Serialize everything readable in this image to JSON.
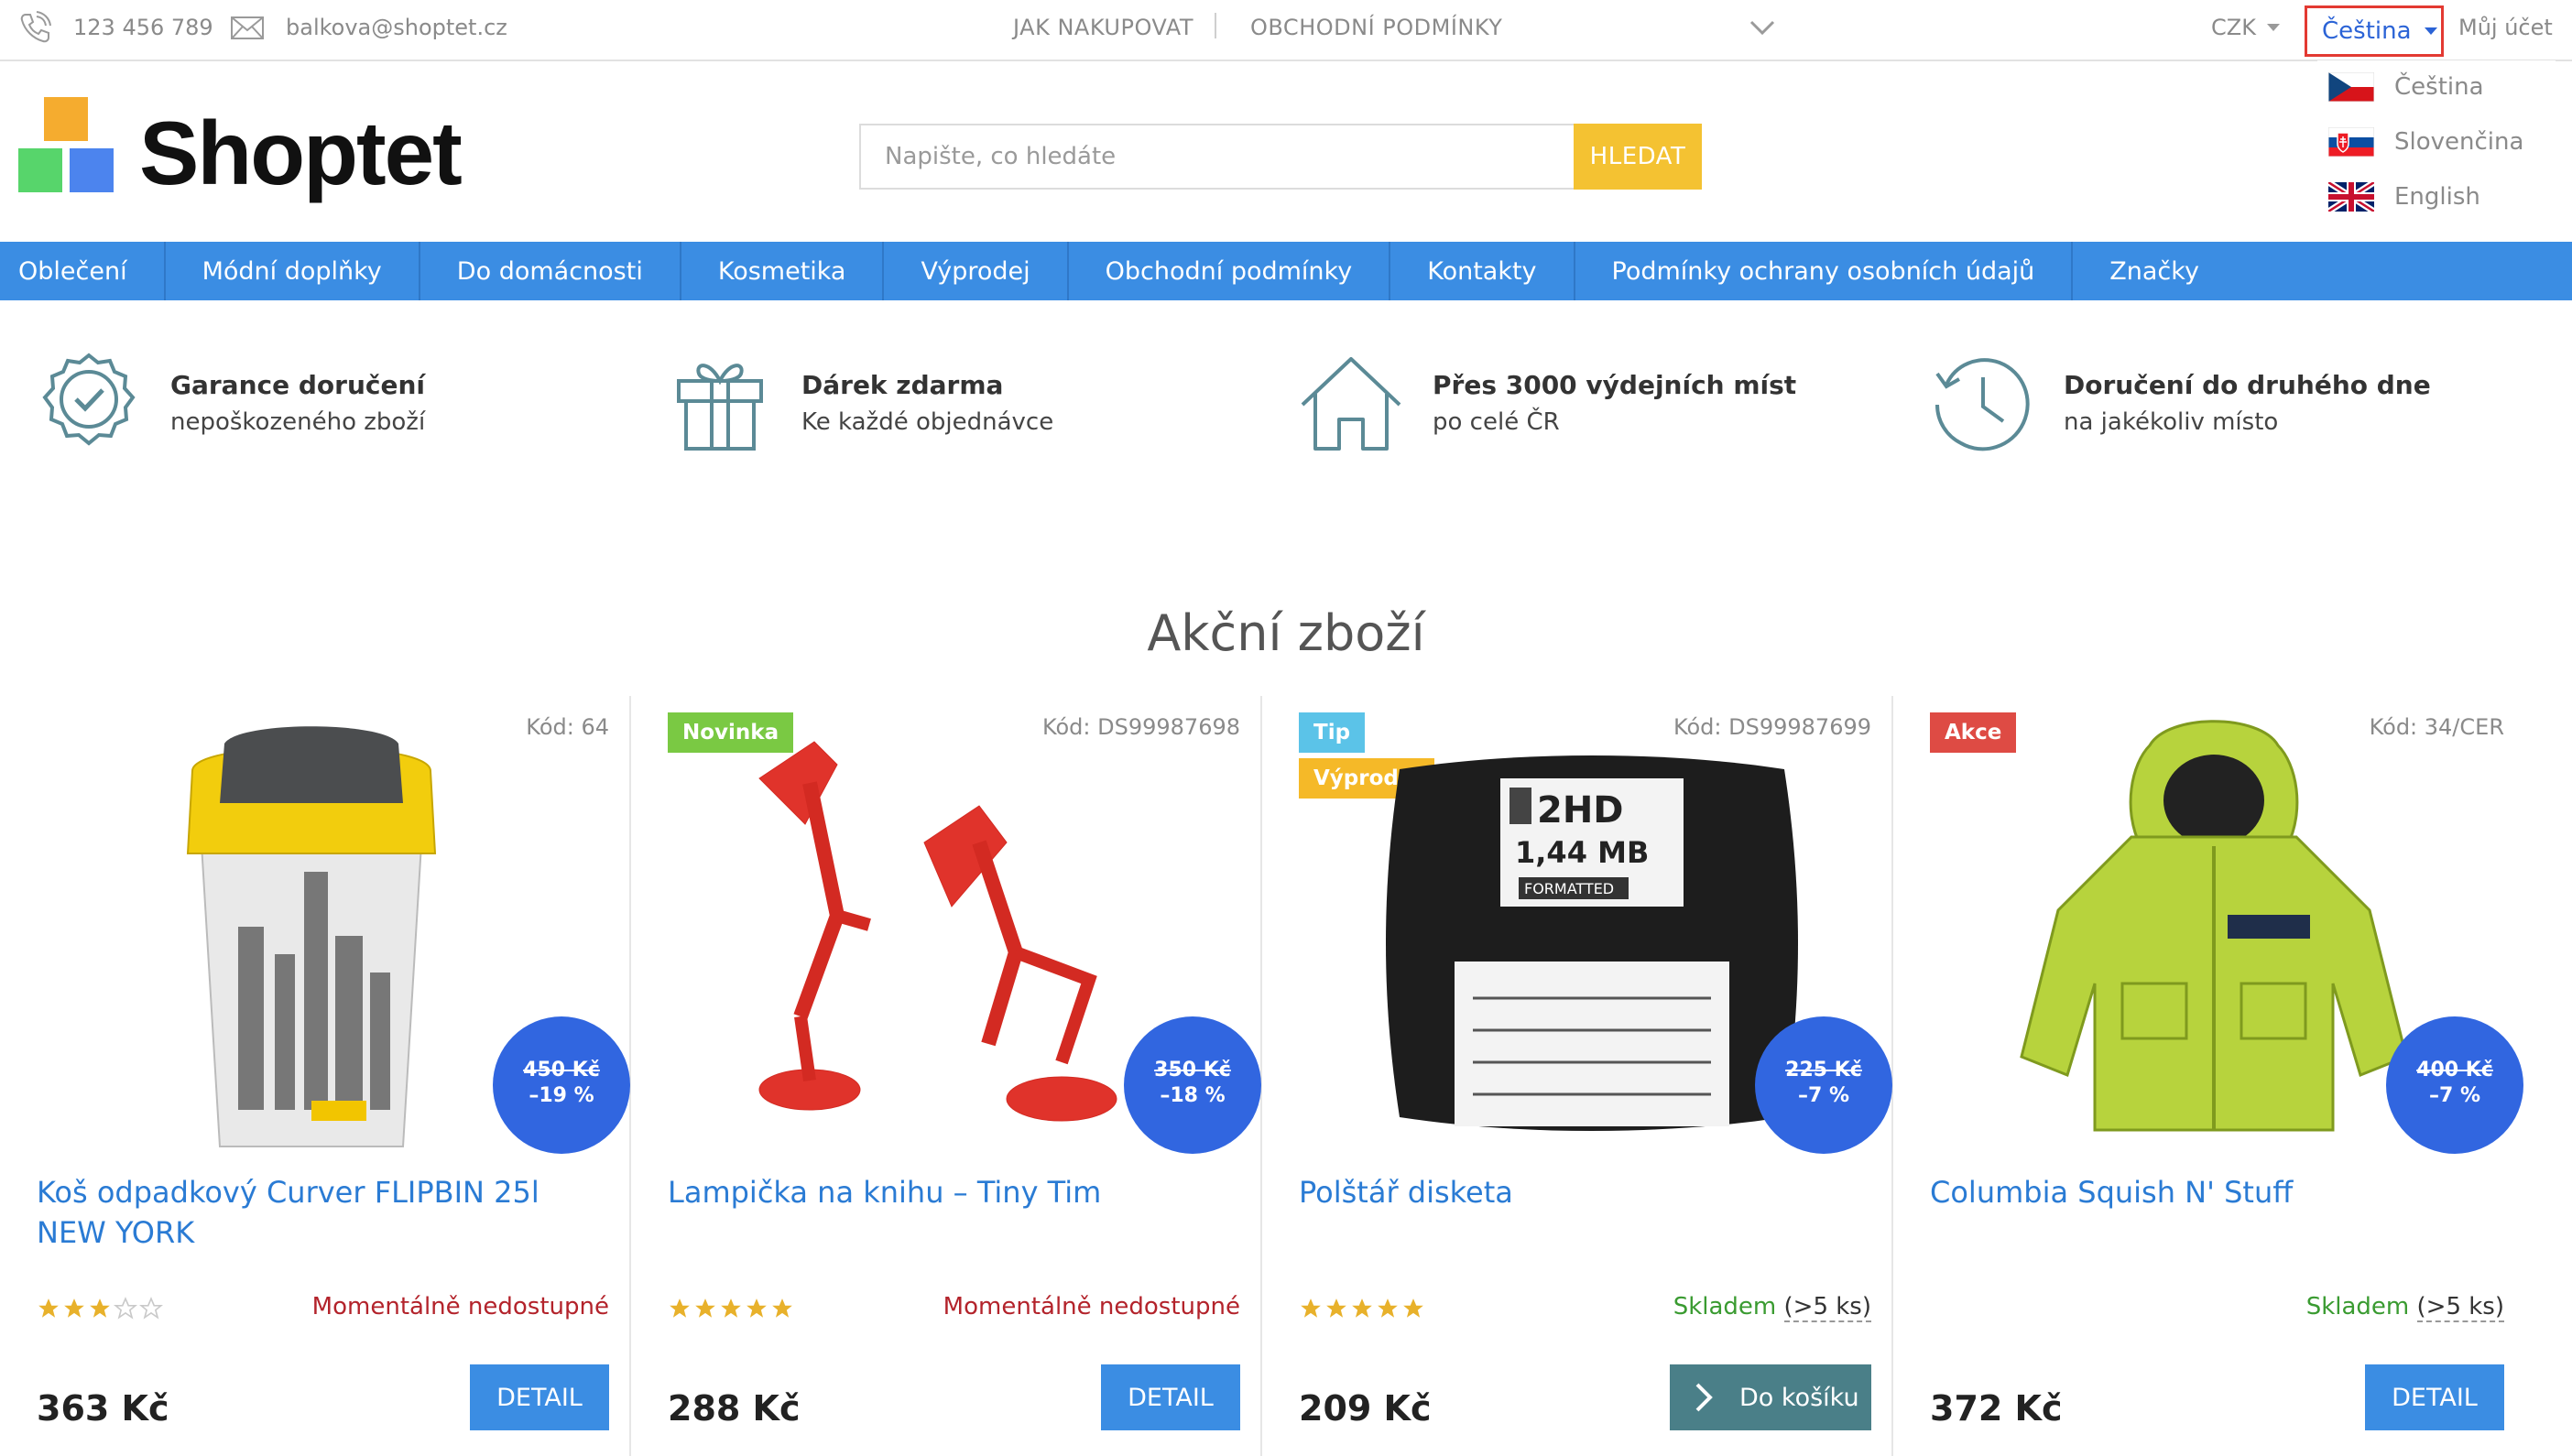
{
  "topbar": {
    "phone": "123 456 789",
    "email": "balkova@shoptet.cz",
    "links": [
      "JAK NAKUPOVAT",
      "OBCHODNÍ PODMÍNKY"
    ],
    "currency": "CZK",
    "language": "Čeština",
    "account": "Můj účet"
  },
  "language_menu": [
    {
      "label": "Čeština",
      "flag": "cz"
    },
    {
      "label": "Slovenčina",
      "flag": "sk"
    },
    {
      "label": "English",
      "flag": "gb"
    }
  ],
  "header": {
    "logo_text": "Shoptet",
    "search_placeholder": "Napište, co hledáte",
    "search_button": "HLEDAT"
  },
  "nav": [
    "Oblečení",
    "Módní doplňky",
    "Do domácnosti",
    "Kosmetika",
    "Výprodej",
    "Obchodní podmínky",
    "Kontakty",
    "Podmínky ochrany osobních údajů",
    "Značky"
  ],
  "benefits": [
    {
      "icon": "badge-check-icon",
      "title": "Garance doručení",
      "subtitle": "nepoškozeného zboží"
    },
    {
      "icon": "gift-icon",
      "title": "Dárek zdarma",
      "subtitle": "Ke každé objednávce"
    },
    {
      "icon": "house-icon",
      "title": "Přes 3000 výdejních míst",
      "subtitle": "po celé ČR"
    },
    {
      "icon": "clock-icon",
      "title": "Doručení do druhého dne",
      "subtitle": "na jakékoliv místo"
    }
  ],
  "section_title": "Akční zboží",
  "products": [
    {
      "code": "Kód: 64",
      "badges": [],
      "old_price": "450 Kč",
      "discount": "–19 %",
      "name": "Koš odpadkový Curver FLIPBIN 25l NEW YORK",
      "rating": 3,
      "availability": "Momentálně nedostupné",
      "availability_extra": "",
      "price": "363 Kč",
      "button": "DETAIL"
    },
    {
      "code": "Kód: DS99987698",
      "badges": [
        {
          "label": "Novinka",
          "color": "#7ac943"
        }
      ],
      "old_price": "350 Kč",
      "discount": "–18 %",
      "name": "Lampička na knihu – Tiny Tim",
      "rating": 5,
      "availability": "Momentálně nedostupné",
      "availability_extra": "",
      "price": "288 Kč",
      "button": "DETAIL"
    },
    {
      "code": "Kód: DS99987699",
      "badges": [
        {
          "label": "Tip",
          "color": "#5bc3e8"
        },
        {
          "label": "Výprodej",
          "color": "#f5b928"
        }
      ],
      "old_price": "225 Kč",
      "discount": "–7 %",
      "name": "Polštář disketa",
      "rating": 5,
      "availability": "Skladem",
      "availability_extra": "(>5 ks)",
      "price": "209 Kč",
      "button": "Do košíku"
    },
    {
      "code": "Kód: 34/CER",
      "badges": [
        {
          "label": "Akce",
          "color": "#de4b44"
        }
      ],
      "old_price": "400 Kč",
      "discount": "–7 %",
      "name": "Columbia Squish N' Stuff",
      "rating": 0,
      "availability": "Skladem",
      "availability_extra": "(>5 ks)",
      "price": "372 Kč",
      "button": "DETAIL"
    }
  ],
  "colors": {
    "accent": "#3b8de3",
    "search_button": "#f4c232",
    "discount": "#3166e0",
    "cart": "#4a7f88",
    "out_of_stock": "#b3232b",
    "in_stock": "#3a9b31",
    "active_language": "#2b63d6"
  }
}
